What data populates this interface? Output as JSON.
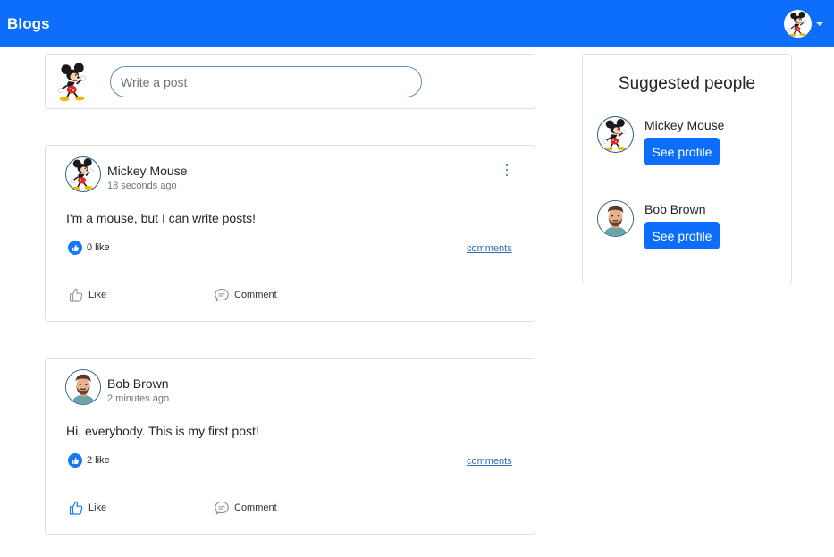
{
  "navbar": {
    "brand": "Blogs",
    "user_avatar": "mickey-avatar",
    "menu_icon": "caret-down-icon",
    "color": "#0d6efd"
  },
  "composer": {
    "placeholder": "Write a post",
    "avatar": "mickey-avatar"
  },
  "posts": [
    {
      "author": "Mickey Mouse",
      "time": "18 seconds ago",
      "content": "I'm a mouse, but I can write posts!",
      "likes": "0 like",
      "comments_link": "comments",
      "like_label": "Like",
      "comment_label": "Comment",
      "avatar": "mickey-avatar",
      "like_icon_active": false
    },
    {
      "author": "Bob Brown",
      "time": "2 minutes ago",
      "content": "Hi, everybody. This is my first post!",
      "likes": "2 like",
      "comments_link": "comments",
      "like_label": "Like",
      "comment_label": "Comment",
      "avatar": "bearded-man-avatar",
      "like_icon_active": true
    }
  ],
  "suggested": {
    "title": "Suggested people",
    "people": [
      {
        "name": "Mickey Mouse",
        "button": "See profile",
        "avatar": "mickey-avatar"
      },
      {
        "name": "Bob Brown",
        "button": "See profile",
        "avatar": "bearded-man-avatar"
      }
    ]
  },
  "colors": {
    "primary": "#0d6efd",
    "like_badge": "#1877f2",
    "link": "#2d6fb0",
    "muted": "#6c757d"
  }
}
